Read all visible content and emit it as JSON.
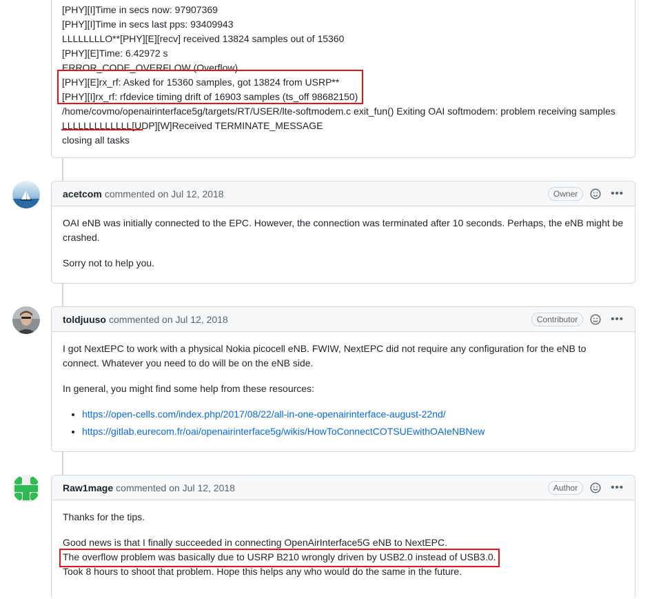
{
  "log": {
    "lines": [
      "[PHY][I]Time in secs now: 97907369",
      "[PHY][I]Time in secs last pps: 93409943",
      "LLLLLLLLO**[PHY][E][recv] received 13824 samples out of 15360",
      "[PHY][E]Time: 6.42972 s",
      "ERROR_CODE_OVERFLOW (Overflow)",
      "[PHY][E]rx_rf: Asked for 15360 samples, got 13824 from USRP**",
      "[PHY][I]rx_rf: rfdevice timing drift of 16903 samples (ts_off 98682150)",
      "/home/covmo/openairinterface5g/targets/RT/USER/lte-softmodem.c exit_fun() Exiting OAI softmodem: problem receiving samples",
      "LLLLLLLLLLLLL[UDP][W]Received TERMINATE_MESSAGE",
      "closing all tasks"
    ]
  },
  "comments": [
    {
      "author": "acetcom",
      "meta": "commented on Jul 12, 2018",
      "role": "Owner",
      "paragraphs": [
        "OAI eNB was initially connected to the EPC. However, the connection was terminated after 10 seconds. Perhaps, the eNB might be crashed.",
        "Sorry not to help you."
      ]
    },
    {
      "author": "toldjuuso",
      "meta": "commented on Jul 12, 2018",
      "role": "Contributor",
      "paragraphs": [
        "I got NextEPC to work with a physical Nokia picocell eNB. FWIW, NextEPC did not require any configuration for the eNB to connect. Whatever you need to do will be on the eNB side.",
        "In general, you might find some help from these resources:"
      ],
      "links": [
        "https://open-cells.com/index.php/2017/08/22/all-in-one-openairinterface-august-22nd/",
        "https://gitlab.eurecom.fr/oai/openairinterface5g/wikis/HowToConnectCOTSUEwithOAIeNBNew"
      ]
    },
    {
      "author": "Raw1mage",
      "meta": "commented on Jul 12, 2018",
      "role": "Author",
      "paragraphs": [
        "Thanks for the tips.",
        "Good news is that I finally succeeded in connecting OpenAirInterface5G eNB to NextEPC.",
        "The overflow problem was basically due to USRP B210 wrongly driven by USB2.0 instead of USB3.0.",
        "Took 8 hours to shoot that problem. Hope this helps any who would do the same in the future."
      ]
    }
  ],
  "icons": {
    "emoji": "smiley-icon",
    "more": "kebab-horizontal-icon"
  },
  "colors": {
    "highlight": "#e0141c",
    "link": "#0969da",
    "border": "#d0d7de",
    "header_bg": "#f6f8fa"
  }
}
